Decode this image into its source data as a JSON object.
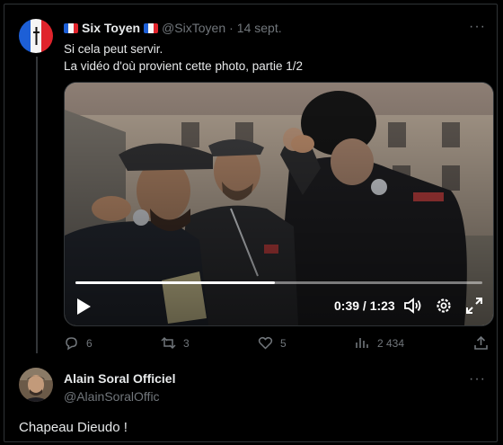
{
  "tweet1": {
    "display_name": "Six Toyen",
    "handle": "@SixToyen",
    "separator": "·",
    "date": "14 sept.",
    "lines": [
      "Si cela peut servir.",
      "La vidéo d'où provient cette photo, partie 1/2"
    ],
    "video": {
      "progress": 0.49,
      "time": "0:39 / 1:23"
    },
    "actions": {
      "replies": "6",
      "reposts": "3",
      "likes": "5",
      "views": "2 434"
    }
  },
  "tweet2": {
    "display_name": "Alain Soral Officiel",
    "handle": "@AlainSoralOffic",
    "text": "Chapeau Dieudo !"
  },
  "more_label": "···",
  "colors": {
    "background": "#000000",
    "text": "#e7e9ea",
    "muted": "#71767b",
    "border": "#2f3336",
    "flag_blue": "#1d5fd6",
    "flag_red": "#e0242c"
  }
}
